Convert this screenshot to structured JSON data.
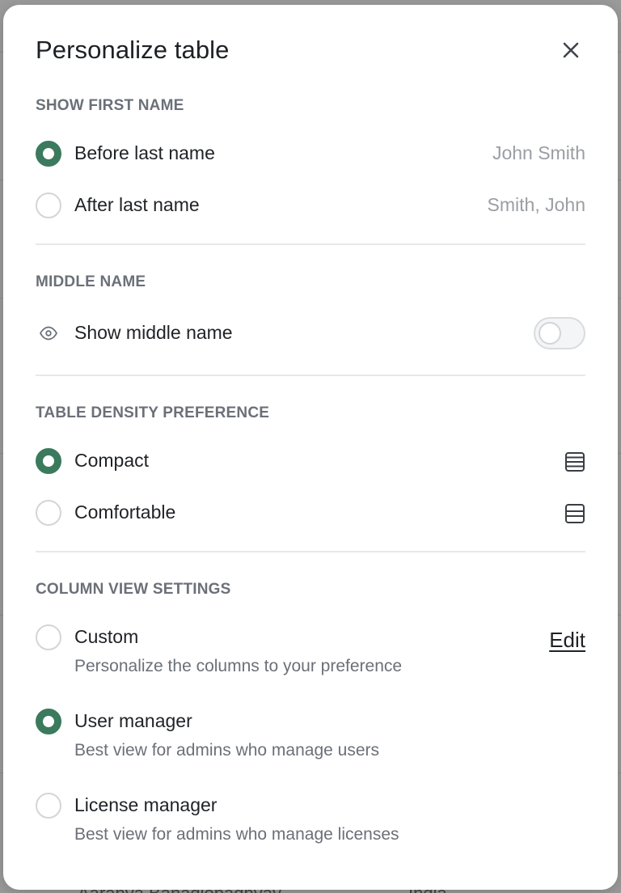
{
  "modal": {
    "title": "Personalize table",
    "close_icon": "close-icon"
  },
  "first_name": {
    "label": "SHOW FIRST NAME",
    "options": [
      {
        "label": "Before last name",
        "example": "John Smith",
        "checked": true
      },
      {
        "label": "After last name",
        "example": "Smith, John",
        "checked": false
      }
    ]
  },
  "middle_name": {
    "label": "MIDDLE NAME",
    "toggle_label": "Show middle name",
    "toggle_on": false,
    "icon": "eye-icon"
  },
  "density": {
    "label": "TABLE DENSITY PREFERENCE",
    "options": [
      {
        "label": "Compact",
        "icon": "compact-rows-icon",
        "checked": true
      },
      {
        "label": "Comfortable",
        "icon": "comfortable-rows-icon",
        "checked": false
      }
    ]
  },
  "columns": {
    "label": "COLUMN VIEW SETTINGS",
    "edit_label": "Edit",
    "options": [
      {
        "label": "Custom",
        "description": "Personalize the columns to your preference",
        "checked": false
      },
      {
        "label": "User manager",
        "description": "Best view for admins who manage users",
        "checked": true
      },
      {
        "label": "License manager",
        "description": "Best view for admins who manage licenses",
        "checked": false
      }
    ]
  },
  "background": {
    "peek_left": "Aaranya Banadiopadhyay",
    "peek_right": "India"
  },
  "colors": {
    "accent": "#3b7a5d",
    "text": "#1f2226",
    "muted": "#6b7078"
  }
}
